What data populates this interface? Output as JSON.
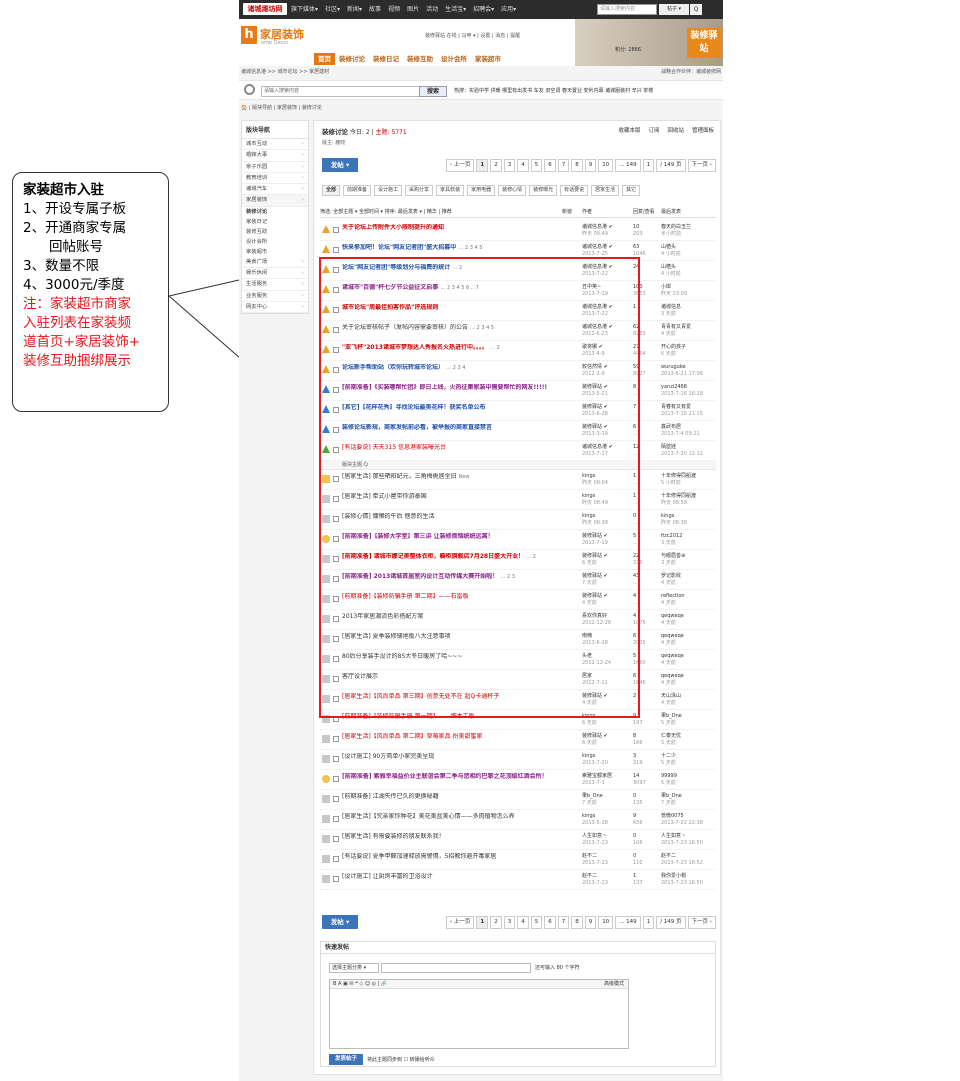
{
  "annotation": {
    "title": "家装超市入驻",
    "lines": [
      "1、开设专属子板",
      "2、开通商家专属",
      "回帖账号",
      "3、数量不限",
      "4、3000元/季度"
    ],
    "note_lines": [
      "注：家装超市商家",
      "入驻列表在家装频",
      "道首页+家居装饰+",
      "装修互助捆绑展示"
    ]
  },
  "topbar": {
    "logo": "诸城潍坊网",
    "nav": [
      "旗下媒体▾",
      "社区▾",
      "新闻▾",
      "故事",
      "视频",
      "图片",
      "活动",
      "生活宝▾",
      "招聘会▾",
      "应用▾"
    ],
    "search_placeholder": "请输入搜索内容",
    "search_type": "帖子 ▾",
    "search_btn": "Q"
  },
  "header": {
    "logo_letter": "h",
    "title": "家居装饰",
    "subtitle": "ome Décor",
    "user_info": "装修驿站 在线 | 马甲 ▾ | 设置 | 消息 | 提醒",
    "points": "积分: 2866",
    "badge": "装修驿站",
    "menu": [
      "首页",
      "装修讨论",
      "装修日记",
      "装修互助",
      "设计会所",
      "家装超市"
    ]
  },
  "breadcrumb": {
    "path": "诸城信息港 >> 城市论坛 >> 家居建材",
    "partner": "战略合作伙伴：诸城装修网"
  },
  "search": {
    "placeholder": "请输入搜索内容",
    "type": "搜索 ▾",
    "button": "搜索",
    "hot": "热搜：实验中学 供暖 哪里有出发书 车友 旧空调 春天置业 安利内幕 诸城服装村 辛兴 茶楼"
  },
  "subcrumb": "🏠 | 版块导航 | 家居装饰 | 装修讨论",
  "sidebar": {
    "header": "版块导航",
    "items": [
      "城市互动",
      "婚嫁大事",
      "亲子乐园",
      "教育培训",
      "诸城汽车",
      "家居装饰"
    ],
    "sub_items": [
      "装修讨论",
      "家装日记",
      "装修互助",
      "设计会所",
      "家装超市"
    ],
    "items2": [
      "美食广场",
      "娱乐休闲",
      "生活服务",
      "业务服务",
      "网友中心"
    ]
  },
  "forum": {
    "name": "装修讨论",
    "today": "今日: 2",
    "topics": "主题: 5771",
    "moderator": "版主: 鹿晓",
    "actions": [
      "收藏本版",
      "订阅",
      "回收站",
      "管理面板"
    ],
    "post_btn": "发帖 ▾",
    "pages": [
      "‹ 上一页",
      "1",
      "2",
      "3",
      "4",
      "5",
      "6",
      "7",
      "8",
      "9",
      "10",
      "... 149",
      "1",
      "/ 149 页",
      "下一页 ›"
    ],
    "tabs": [
      "全部",
      "前期准备",
      "设计施工",
      "采购分享",
      "家具软装",
      "家用电器",
      "装修心情",
      "装修曝光",
      "有话要说",
      "居家生活",
      "其它"
    ],
    "filter": "筛选: 全部主题 ▾  全部时间 ▾  排序: 最后发表 ▾  |  精华  |  推荐",
    "col_new": "新窗",
    "col_author": "作者",
    "col_reply": "回复/查看",
    "col_last": "最后发表",
    "separator": "版块主题 🗘"
  },
  "threads": [
    {
      "icon": "up",
      "style": "red",
      "title": "关于论坛上传附件大小限制提升的通知",
      "pg": "",
      "author": "诸城信息港 ✔",
      "adate": "昨天 09:49",
      "n1": "10",
      "n2": "203",
      "lp": "春天的白玉兰",
      "ldate": "半小时前"
    },
    {
      "icon": "up",
      "style": "blue",
      "title": "快来参加吧！论坛\"网友记者团\"盛大招募中",
      "pg": "… 2 3 4 5",
      "author": "诸城信息港 ✔",
      "adate": "2013-7-25",
      "n1": "63",
      "n2": "1046",
      "lp": "山楂头",
      "ldate": "4 小时前"
    },
    {
      "icon": "up",
      "style": "blue",
      "title": "论坛\"网友记者团\"等级划分与福费的统计",
      "pg": "… 2",
      "author": "诸城信息港 ✔",
      "adate": "2013-7-22",
      "n1": "24",
      "n2": "...",
      "lp": "山楂头",
      "ldate": "4 小时前"
    },
    {
      "icon": "up",
      "style": "purple",
      "title": "诸城市\"百德\"杯七夕节公益征文启事",
      "pg": "… 2 3 4 5 6 .. 7",
      "author": "丑中英~",
      "adate": "2013-7-19",
      "n1": "100",
      "n2": "3653",
      "lp": "小岸",
      "ldate": "昨天 23:09"
    },
    {
      "icon": "up",
      "style": "red",
      "title": "城市论坛\"周最佳拍客作品\"评选规则",
      "pg": "",
      "author": "诸城信息港 ✔",
      "adate": "2013-7-22",
      "n1": "1",
      "n2": "...",
      "lp": "诸城信息",
      "ldate": "3 天前"
    },
    {
      "icon": "up",
      "style": "",
      "title": "关于论坛审核帖子（发帖内容需要审核）的公告",
      "pg": "… 2 3 4 5",
      "author": "诸城信息港 ✔",
      "adate": "2012-6-23",
      "n1": "62",
      "n2": "8283",
      "lp": "青青有又青爱",
      "ldate": "4 天前"
    },
    {
      "icon": "up",
      "style": "red",
      "title": "\"亚飞杯\"2013诸城市梦想达人秀报名火热进行中。。。。",
      "pg": "… 2",
      "author": "歌将娜 ✔",
      "adate": "2013-4-9",
      "n1": "27",
      "n2": "4464",
      "lp": "开心的孩子",
      "ldate": "6 天前"
    },
    {
      "icon": "up",
      "style": "blue",
      "title": "论坛新手帮助站（欢你玩转城市论坛）",
      "pg": "… 2 3 4",
      "author": "软信然情 ✔",
      "adate": "2012-3-9",
      "n1": "59",
      "n2": "8927",
      "lp": "wuruguke",
      "ldate": "2013-6-21 17:06"
    },
    {
      "icon": "up blue",
      "style": "purple",
      "title": "[前期准备]《买装哪帮忙团》即日上线，火热征集家装中需要帮忙的网友!!!!!",
      "pg": "",
      "author": "装修驿站 ✔",
      "adate": "2013-5-21",
      "n1": "8",
      "n2": "...",
      "lp": "yanzi2468",
      "ldate": "2013-7-16 16:28"
    },
    {
      "icon": "up blue",
      "style": "blue",
      "title": "[其它]【花样花秀】寻找论坛最美花样！获奖名单公布",
      "pg": "",
      "author": "装修驿站 ✔",
      "adate": "2013-6-28",
      "n1": "7",
      "n2": "...",
      "lp": "青春有又有爱",
      "ldate": "2013-7-15 21:15"
    },
    {
      "icon": "up blue",
      "style": "blue",
      "title": "装修论坛新规，商家发帖前必看，被举报的商家直接禁言",
      "pg": "",
      "author": "装修驿站 ✔",
      "adate": "2013-3-19",
      "n1": "6",
      "n2": "...",
      "lp": "粪武布居",
      "ldate": "2013-7-4 09:21"
    },
    {
      "icon": "up green",
      "style": "redn",
      "title": "[有话要说] 天天315 信息港家装曝光台",
      "pg": "",
      "author": "诸城信息港 ✔",
      "adate": "2013-7-17",
      "n1": "12",
      "n2": "...",
      "lp": "陌蓝娃",
      "ldate": "2013-7-20 12:12"
    },
    {
      "sep": true
    },
    {
      "icon": "folder",
      "style": "",
      "title": "[居家生活] 那些晒阳纪元，三角梅栀居坐旧",
      "pg": "New",
      "author": "kings",
      "adate": "昨天 09:04",
      "n1": "1",
      "n2": "...",
      "lp": "十年修得同船渡",
      "ldate": "5 小时前"
    },
    {
      "icon": "gray",
      "style": "",
      "title": "[居家生活] 牵式小屋带你游泰国",
      "pg": "",
      "author": "kings",
      "adate": "昨天 08:49",
      "n1": "1",
      "n2": "...",
      "lp": "十年修得同船渡",
      "ldate": "昨天 08:58"
    },
    {
      "icon": "gray",
      "style": "",
      "title": "[装修心情] 慵懒的午后 惬意的生活",
      "pg": "",
      "author": "kings",
      "adate": "昨天 08:38",
      "n1": "0",
      "n2": "...",
      "lp": "kings",
      "ldate": "昨天 08:38"
    },
    {
      "icon": "smile",
      "style": "purple",
      "title": "[前期准备]【装修大学堂】第三讲 让装修烦恼统统远离！",
      "pg": "",
      "author": "装修驿站 ✔",
      "adate": "2013-7-19",
      "n1": "5",
      "n2": "...",
      "lp": "fizc2012",
      "ldate": "3 天前"
    },
    {
      "icon": "gray",
      "style": "red",
      "title": "[前期准备] 诸城市娜记美整体衣柜，橱柜旗舰店7月28日盛大开业！",
      "pg": "… 2",
      "author": "装修驿站 ✔",
      "adate": "6 天前",
      "n1": "22",
      "n2": "376",
      "lp": "与眼眉善⊕",
      "ldate": "3 天前"
    },
    {
      "icon": "gray",
      "style": "purple",
      "title": "[前期准备] 2013诸城首届室内设计互动传媒大赛开始啦！",
      "pg": "… 2 3",
      "author": "装修驿站 ✔",
      "adate": "7 天前",
      "n1": "43",
      "n2": "...",
      "lp": "罗记影收",
      "ldate": "4 天前"
    },
    {
      "icon": "gray",
      "style": "redn",
      "title": "[前期准备]【装修防骗手册 第二期】——石雷板",
      "pg": "",
      "author": "装修驿站 ✔",
      "adate": "4 天前",
      "n1": "4",
      "n2": "...",
      "lp": "reflection",
      "ldate": "4 天前"
    },
    {
      "icon": "gray",
      "style": "",
      "title": "2013年家居潮流色彩搭配方案",
      "pg": "",
      "author": "喜欢你真好",
      "adate": "2012-12-28",
      "n1": "4",
      "n2": "1075",
      "lp": "qeqweqe",
      "ldate": "4 天前"
    },
    {
      "icon": "gray",
      "style": "",
      "title": "[居家生活] 夏季装修铺地板八大注意事项",
      "pg": "",
      "author": "南楠",
      "adate": "2013-6-28",
      "n1": "6",
      "n2": "2035",
      "lp": "qeqweqe",
      "ldate": "4 天前"
    },
    {
      "icon": "gray",
      "style": "",
      "title": "80后分享装手设计的85大冬日暖房了哈~~~",
      "pg": "",
      "author": "头老",
      "adate": "2012-12-24",
      "n1": "5",
      "n2": "1660",
      "lp": "qeqweqe",
      "ldate": "4 天前"
    },
    {
      "icon": "gray",
      "style": "",
      "title": "客厅设计展示",
      "pg": "",
      "author": "居家",
      "adate": "2012-7-11",
      "n1": "6",
      "n2": "1846",
      "lp": "qeqweqe",
      "ldate": "4 天前"
    },
    {
      "icon": "gray",
      "style": "redn",
      "title": "[居家生活]【风尚单品 第三期】创意无处不在 超Q卡通杯子",
      "pg": "",
      "author": "装修驿站 ✔",
      "adate": "4 天前",
      "n1": "2",
      "n2": "...",
      "lp": "天山泳山",
      "ldate": "4 天前"
    },
    {
      "icon": "gray",
      "style": "redn",
      "title": "[前期准备]【装修防骗手册 第一期】——细木工板",
      "pg": "",
      "author": "kings",
      "adate": "6 天前",
      "n1": "9",
      "n2": "197",
      "lp": "果b_One",
      "ldate": "5 天前"
    },
    {
      "icon": "gray",
      "style": "redn",
      "title": "[居家生活]【风尚单品 第二期】草莓家品 扮美甜蜜家",
      "pg": "",
      "author": "装修驿站 ✔",
      "adate": "6 天前",
      "n1": "8",
      "n2": "166",
      "lp": "仁泰无忧",
      "ldate": "5 天前"
    },
    {
      "icon": "gray",
      "style": "",
      "title": "[设计施工] 90方简单小家完美呈现",
      "pg": "",
      "author": "kings",
      "adate": "2013-7-20",
      "n1": "3",
      "n2": "319",
      "lp": "十二少",
      "ldate": "5 天前"
    },
    {
      "icon": "smile",
      "style": "purple",
      "title": "[前期准备] 索雅幸福益价业主联谊会第二季与您相约巴黎之花顶级红酒会所！",
      "pg": "",
      "author": "索雅宝都家居",
      "adate": "2013-7-1",
      "n1": "14",
      "n2": "3097",
      "lp": "99999",
      "ldate": "5 天前"
    },
    {
      "icon": "gray",
      "style": "",
      "title": "[前期准备] 江湖失传已久的更换秘籍",
      "pg": "",
      "author": "果b_One",
      "adate": "7 天前",
      "n1": "0",
      "n2": "135",
      "lp": "果b_One",
      "ldate": "7 天前"
    },
    {
      "icon": "gray",
      "style": "",
      "title": "[居家生活]【究亲家你种花】美花美盆美心情——多肉植物怎么养",
      "pg": "",
      "author": "kings",
      "adate": "2013-5-28",
      "n1": "9",
      "n2": "656",
      "lp": "管微0075",
      "ldate": "2013-7-22 22:38"
    },
    {
      "icon": "gray",
      "style": "",
      "title": "[居家生活] 有需要装修的朋友联系我！",
      "pg": "",
      "author": "人生如意丶",
      "adate": "2013-7-23",
      "n1": "0",
      "n2": "106",
      "lp": "人生如意丶",
      "ldate": "2013-7-23 16:50"
    },
    {
      "icon": "gray",
      "style": "",
      "title": "[有话要说] 夏季甲醛加速释放需警惕，5招教你避开毒家居",
      "pg": "",
      "author": "赵不二",
      "adate": "2013-7-23",
      "n1": "0",
      "n2": "110",
      "lp": "赵不二",
      "ldate": "2013-7-23 16:52"
    },
    {
      "icon": "gray",
      "style": "",
      "title": "[设计施工] 让厨房丰富的卫浴设计",
      "pg": "",
      "author": "赵不二",
      "adate": "2013-7-23",
      "n1": "1",
      "n2": "137",
      "lp": "我你爱小帽",
      "ldate": "2013-7-23 16:50"
    }
  ],
  "quickpost": {
    "title": "快速发帖",
    "cat": "选择主题分类 ▾",
    "limit": "还可输入 80 个字符",
    "toolbar": "B  A  ▣  ✉  ❝  ◇  ☺  ◎  |  🔗",
    "adv": "高级模式",
    "submit": "发表帖子",
    "sync": "将此主题同步到  ☐ 转播给听众"
  }
}
